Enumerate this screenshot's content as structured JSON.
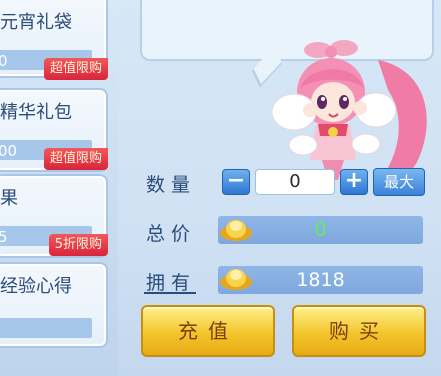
{
  "shop_items": [
    {
      "name": "元宵礼袋",
      "num": "0",
      "badge": "超值限购"
    },
    {
      "name": "精华礼包",
      "num": "00",
      "badge": "超值限购"
    },
    {
      "name": "果",
      "num": "5",
      "badge": "5折限购"
    },
    {
      "name": "经验心得",
      "num": "",
      "badge": ""
    }
  ],
  "purchase": {
    "quantity_label": "数量",
    "quantity_value": "0",
    "minus": "−",
    "plus": "+",
    "max_label": "最大",
    "total_label": "总价",
    "total_value": "0",
    "own_label": "拥有",
    "own_value": "1818"
  },
  "buttons": {
    "recharge": "充值",
    "buy": "购买"
  },
  "colors": {
    "badge_red": "#d9243b",
    "total_green": "#5df05a",
    "gold": "#f3c52c"
  },
  "icons": [
    "gold-ingot-icon",
    "mascot-character"
  ]
}
